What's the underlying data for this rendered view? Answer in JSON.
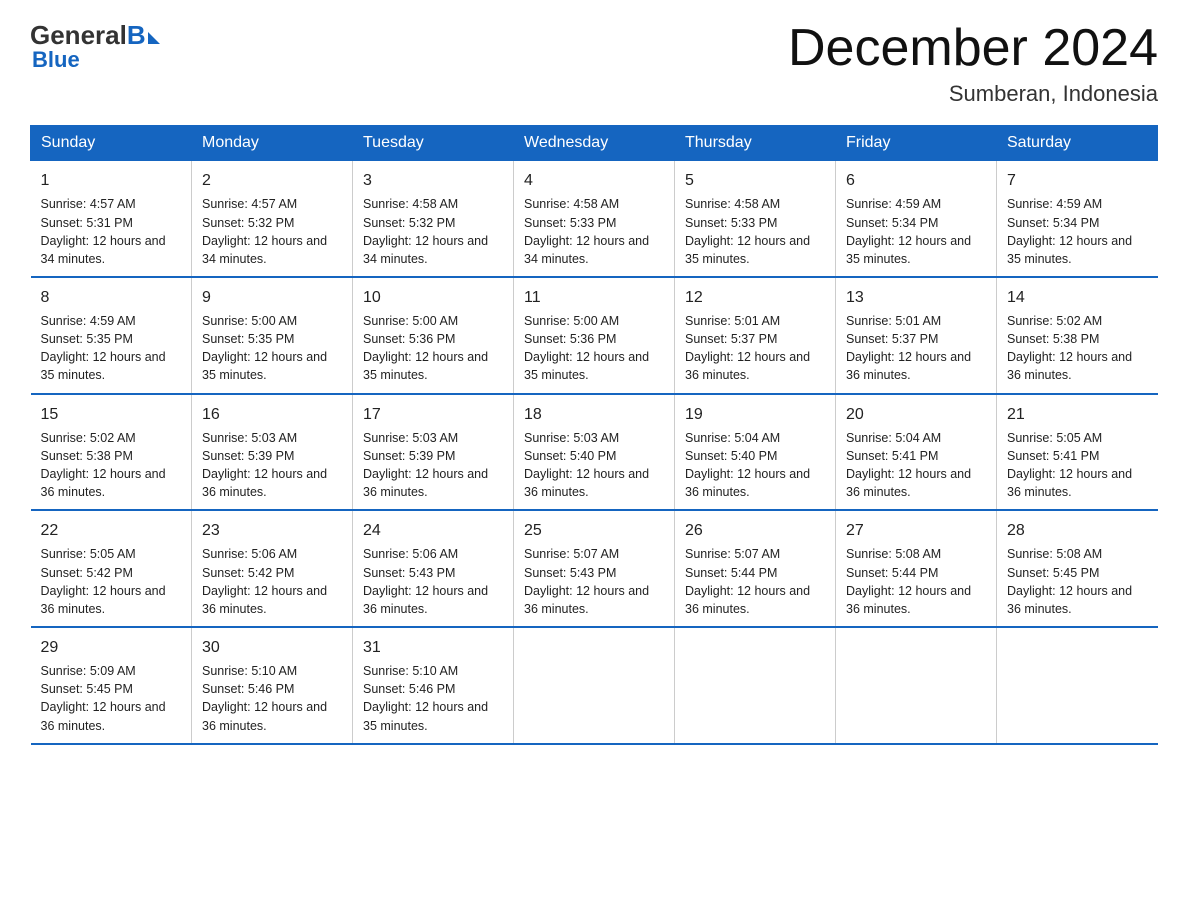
{
  "header": {
    "logo_general": "General",
    "logo_blue": "Blue",
    "month_year": "December 2024",
    "location": "Sumberan, Indonesia"
  },
  "weekdays": [
    "Sunday",
    "Monday",
    "Tuesday",
    "Wednesday",
    "Thursday",
    "Friday",
    "Saturday"
  ],
  "weeks": [
    [
      {
        "day": "1",
        "sunrise": "4:57 AM",
        "sunset": "5:31 PM",
        "daylight": "12 hours and 34 minutes."
      },
      {
        "day": "2",
        "sunrise": "4:57 AM",
        "sunset": "5:32 PM",
        "daylight": "12 hours and 34 minutes."
      },
      {
        "day": "3",
        "sunrise": "4:58 AM",
        "sunset": "5:32 PM",
        "daylight": "12 hours and 34 minutes."
      },
      {
        "day": "4",
        "sunrise": "4:58 AM",
        "sunset": "5:33 PM",
        "daylight": "12 hours and 34 minutes."
      },
      {
        "day": "5",
        "sunrise": "4:58 AM",
        "sunset": "5:33 PM",
        "daylight": "12 hours and 35 minutes."
      },
      {
        "day": "6",
        "sunrise": "4:59 AM",
        "sunset": "5:34 PM",
        "daylight": "12 hours and 35 minutes."
      },
      {
        "day": "7",
        "sunrise": "4:59 AM",
        "sunset": "5:34 PM",
        "daylight": "12 hours and 35 minutes."
      }
    ],
    [
      {
        "day": "8",
        "sunrise": "4:59 AM",
        "sunset": "5:35 PM",
        "daylight": "12 hours and 35 minutes."
      },
      {
        "day": "9",
        "sunrise": "5:00 AM",
        "sunset": "5:35 PM",
        "daylight": "12 hours and 35 minutes."
      },
      {
        "day": "10",
        "sunrise": "5:00 AM",
        "sunset": "5:36 PM",
        "daylight": "12 hours and 35 minutes."
      },
      {
        "day": "11",
        "sunrise": "5:00 AM",
        "sunset": "5:36 PM",
        "daylight": "12 hours and 35 minutes."
      },
      {
        "day": "12",
        "sunrise": "5:01 AM",
        "sunset": "5:37 PM",
        "daylight": "12 hours and 36 minutes."
      },
      {
        "day": "13",
        "sunrise": "5:01 AM",
        "sunset": "5:37 PM",
        "daylight": "12 hours and 36 minutes."
      },
      {
        "day": "14",
        "sunrise": "5:02 AM",
        "sunset": "5:38 PM",
        "daylight": "12 hours and 36 minutes."
      }
    ],
    [
      {
        "day": "15",
        "sunrise": "5:02 AM",
        "sunset": "5:38 PM",
        "daylight": "12 hours and 36 minutes."
      },
      {
        "day": "16",
        "sunrise": "5:03 AM",
        "sunset": "5:39 PM",
        "daylight": "12 hours and 36 minutes."
      },
      {
        "day": "17",
        "sunrise": "5:03 AM",
        "sunset": "5:39 PM",
        "daylight": "12 hours and 36 minutes."
      },
      {
        "day": "18",
        "sunrise": "5:03 AM",
        "sunset": "5:40 PM",
        "daylight": "12 hours and 36 minutes."
      },
      {
        "day": "19",
        "sunrise": "5:04 AM",
        "sunset": "5:40 PM",
        "daylight": "12 hours and 36 minutes."
      },
      {
        "day": "20",
        "sunrise": "5:04 AM",
        "sunset": "5:41 PM",
        "daylight": "12 hours and 36 minutes."
      },
      {
        "day": "21",
        "sunrise": "5:05 AM",
        "sunset": "5:41 PM",
        "daylight": "12 hours and 36 minutes."
      }
    ],
    [
      {
        "day": "22",
        "sunrise": "5:05 AM",
        "sunset": "5:42 PM",
        "daylight": "12 hours and 36 minutes."
      },
      {
        "day": "23",
        "sunrise": "5:06 AM",
        "sunset": "5:42 PM",
        "daylight": "12 hours and 36 minutes."
      },
      {
        "day": "24",
        "sunrise": "5:06 AM",
        "sunset": "5:43 PM",
        "daylight": "12 hours and 36 minutes."
      },
      {
        "day": "25",
        "sunrise": "5:07 AM",
        "sunset": "5:43 PM",
        "daylight": "12 hours and 36 minutes."
      },
      {
        "day": "26",
        "sunrise": "5:07 AM",
        "sunset": "5:44 PM",
        "daylight": "12 hours and 36 minutes."
      },
      {
        "day": "27",
        "sunrise": "5:08 AM",
        "sunset": "5:44 PM",
        "daylight": "12 hours and 36 minutes."
      },
      {
        "day": "28",
        "sunrise": "5:08 AM",
        "sunset": "5:45 PM",
        "daylight": "12 hours and 36 minutes."
      }
    ],
    [
      {
        "day": "29",
        "sunrise": "5:09 AM",
        "sunset": "5:45 PM",
        "daylight": "12 hours and 36 minutes."
      },
      {
        "day": "30",
        "sunrise": "5:10 AM",
        "sunset": "5:46 PM",
        "daylight": "12 hours and 36 minutes."
      },
      {
        "day": "31",
        "sunrise": "5:10 AM",
        "sunset": "5:46 PM",
        "daylight": "12 hours and 35 minutes."
      },
      null,
      null,
      null,
      null
    ]
  ],
  "labels": {
    "sunrise_prefix": "Sunrise: ",
    "sunset_prefix": "Sunset: ",
    "daylight_prefix": "Daylight: "
  }
}
